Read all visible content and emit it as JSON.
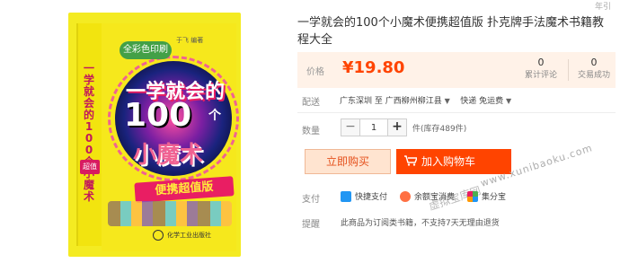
{
  "book_cover": {
    "spine_title": "一学就会的100个小魔术",
    "spine_badge": "超值",
    "badge": "全彩色印刷",
    "author": "于飞 编著",
    "title_line1": "一学就会的",
    "title_number": "100",
    "title_measure": "个",
    "title_line2": "小魔术",
    "banner": "便携超值版",
    "publisher": "化学工业出版社"
  },
  "top_ghost_text": "年引",
  "product": {
    "title": "一学就会的100个小魔术便携超值版 扑克牌手法魔术书籍教程大全",
    "price_label": "价格",
    "price": "¥19.80",
    "review_count": "0",
    "review_label": "累计评论",
    "sales_count": "0",
    "sales_label": "交易成功"
  },
  "shipping": {
    "label": "配送",
    "from": "广东深圳",
    "to_word": "至",
    "to": "广西柳州柳江县",
    "method": "快递 免运费"
  },
  "quantity": {
    "label": "数量",
    "minus": "−",
    "value": "1",
    "plus": "+",
    "stock": "件(库存489件)"
  },
  "actions": {
    "buy_now": "立即购买",
    "add_cart": "加入购物车"
  },
  "payment": {
    "label": "支付",
    "options": [
      "快捷支付",
      "余额宝消费",
      "集分宝"
    ]
  },
  "hint": {
    "label": "提醒",
    "text": "此商品为订阅类书籍，不支持7天无理由退货"
  },
  "watermark": {
    "url": "www.xunibaoku.com",
    "brand": "虚拟宝库网"
  },
  "colors": {
    "accent": "#ff4400",
    "price_bg": "#fff2e8",
    "buy_bg": "#ffe4d0"
  }
}
